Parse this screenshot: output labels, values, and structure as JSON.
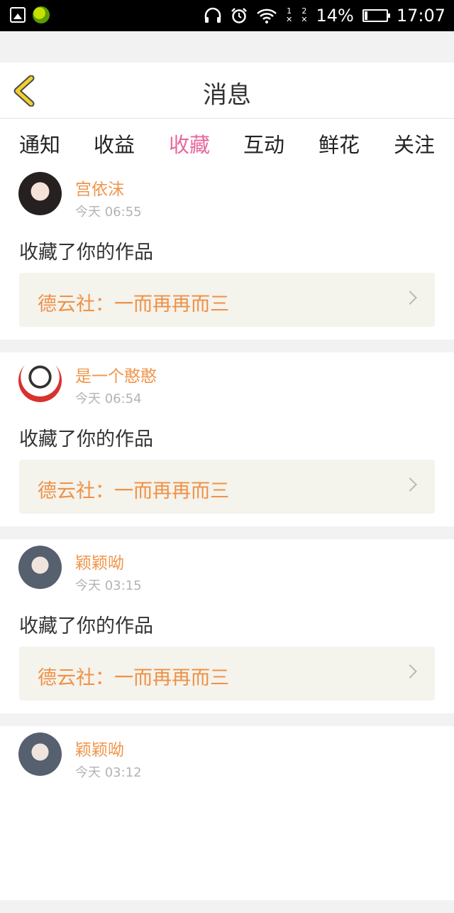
{
  "status_bar": {
    "left_icons": [
      "gallery-icon",
      "app-icon"
    ],
    "headphone_icon": "headphone-icon",
    "alarm_icon": "alarm-icon",
    "wifi_icon": "wifi-icon",
    "sim1": "1",
    "sim2": "2",
    "battery_percent": "14%",
    "battery_level": 0.14,
    "time": "17:07"
  },
  "header": {
    "back_icon": "back-chevron-icon",
    "title": "消息"
  },
  "tabs": [
    {
      "label": "通知"
    },
    {
      "label": "收益"
    },
    {
      "label": "收藏",
      "active": true
    },
    {
      "label": "互动"
    },
    {
      "label": "鲜花"
    },
    {
      "label": "关注"
    }
  ],
  "items": [
    {
      "user": "宫依沫",
      "time": "今天 06:55",
      "action": "收藏了你的作品",
      "work": "德云社：一而再再而三"
    },
    {
      "user": "是一个憨憨",
      "time": "今天 06:54",
      "action": "收藏了你的作品",
      "work": "德云社：一而再再而三"
    },
    {
      "user": "颖颖呦",
      "time": "今天 03:15",
      "action": "收藏了你的作品",
      "work": "德云社：一而再再而三"
    },
    {
      "user": "颖颖呦",
      "time": "今天 03:12",
      "action": "",
      "work": ""
    }
  ],
  "colors": {
    "accent_pink": "#e8679e",
    "username_orange": "#f0954b",
    "work_bg": "#f4f3ec",
    "back_icon_yellow": "#f2d02e"
  }
}
